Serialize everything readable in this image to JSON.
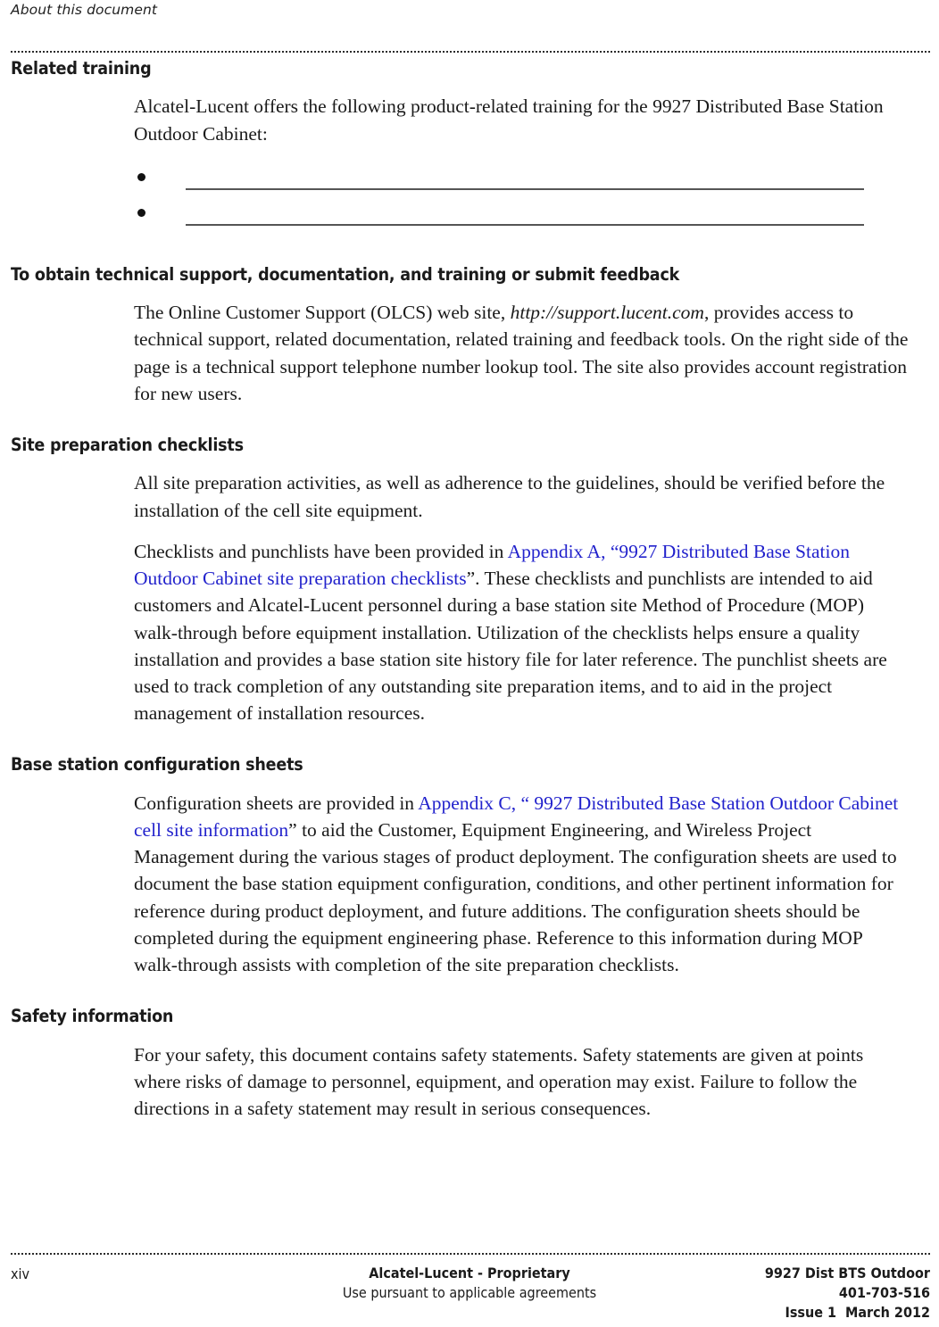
{
  "header": {
    "running_title": "About this document"
  },
  "sections": [
    {
      "heading": "Related training",
      "intro": "Alcatel-Lucent offers the following product-related training for the 9927 Distributed Base Station Outdoor Cabinet:",
      "blank_items": [
        "",
        ""
      ]
    },
    {
      "heading": "To obtain technical support, documentation, and training or submit feedback",
      "para_pre": "The Online Customer Support (OLCS) web site, ",
      "para_url": "http://support.lucent.com",
      "para_post": ", provides access to technical support, related documentation, related training and feedback tools. On the right side of the page is a technical support telephone number lookup tool. The site also provides account registration for new users."
    },
    {
      "heading": "Site preparation checklists",
      "para1": "All site preparation activities, as well as adherence to the guidelines, should be verified before the installation of the cell site equipment.",
      "para2_pre": "Checklists and punchlists have been provided in ",
      "para2_link": "Appendix A, “9927 Distributed Base Station Outdoor Cabinet site preparation checklists",
      "para2_post": "”. These checklists and punchlists are intended to aid customers and Alcatel-Lucent personnel during a base station site Method of Procedure (MOP) walk-through before equipment installation. Utilization of the checklists helps ensure a quality installation and provides a base station site history file for later reference. The punchlist sheets are used to track completion of any outstanding site preparation items, and to aid in the project management of installation resources."
    },
    {
      "heading": "Base station configuration sheets",
      "para_pre": "Configuration sheets are provided in ",
      "para_link": "Appendix C, “ 9927 Distributed Base Station Outdoor Cabinet cell site information",
      "para_post": "” to aid the Customer, Equipment Engineering, and Wireless Project Management during the various stages of product deployment. The configuration sheets are used to document the base station equipment configuration, conditions, and other pertinent information for reference during product deployment, and future additions. The configuration sheets should be completed during the equipment engineering phase. Reference to this information during MOP walk-through assists with completion of the site preparation checklists."
    },
    {
      "heading": "Safety information",
      "para1": "For your safety, this document contains safety statements. Safety statements are given at points where risks of damage to personnel, equipment, and operation may exist. Failure to follow the directions in a safety statement may result in serious consequences."
    }
  ],
  "footer": {
    "page_number": "xiv",
    "center_line1": "Alcatel-Lucent - Proprietary",
    "center_line2": "Use pursuant to applicable agreements",
    "right_line1": "9927 Dist BTS Outdoor",
    "right_line2": "401-703-516",
    "right_issue": "Issue 1",
    "right_date": "March 2012"
  },
  "colors": {
    "link": "#2222cc",
    "text": "#1a1a1a",
    "rule": "#2b2b2b"
  }
}
